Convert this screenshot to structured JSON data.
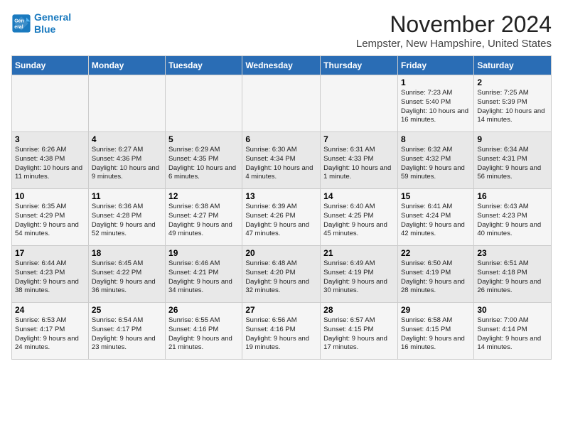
{
  "logo": {
    "line1": "General",
    "line2": "Blue"
  },
  "title": "November 2024",
  "location": "Lempster, New Hampshire, United States",
  "days_of_week": [
    "Sunday",
    "Monday",
    "Tuesday",
    "Wednesday",
    "Thursday",
    "Friday",
    "Saturday"
  ],
  "weeks": [
    [
      {
        "num": "",
        "info": ""
      },
      {
        "num": "",
        "info": ""
      },
      {
        "num": "",
        "info": ""
      },
      {
        "num": "",
        "info": ""
      },
      {
        "num": "",
        "info": ""
      },
      {
        "num": "1",
        "info": "Sunrise: 7:23 AM\nSunset: 5:40 PM\nDaylight: 10 hours and 16 minutes."
      },
      {
        "num": "2",
        "info": "Sunrise: 7:25 AM\nSunset: 5:39 PM\nDaylight: 10 hours and 14 minutes."
      }
    ],
    [
      {
        "num": "3",
        "info": "Sunrise: 6:26 AM\nSunset: 4:38 PM\nDaylight: 10 hours and 11 minutes."
      },
      {
        "num": "4",
        "info": "Sunrise: 6:27 AM\nSunset: 4:36 PM\nDaylight: 10 hours and 9 minutes."
      },
      {
        "num": "5",
        "info": "Sunrise: 6:29 AM\nSunset: 4:35 PM\nDaylight: 10 hours and 6 minutes."
      },
      {
        "num": "6",
        "info": "Sunrise: 6:30 AM\nSunset: 4:34 PM\nDaylight: 10 hours and 4 minutes."
      },
      {
        "num": "7",
        "info": "Sunrise: 6:31 AM\nSunset: 4:33 PM\nDaylight: 10 hours and 1 minute."
      },
      {
        "num": "8",
        "info": "Sunrise: 6:32 AM\nSunset: 4:32 PM\nDaylight: 9 hours and 59 minutes."
      },
      {
        "num": "9",
        "info": "Sunrise: 6:34 AM\nSunset: 4:31 PM\nDaylight: 9 hours and 56 minutes."
      }
    ],
    [
      {
        "num": "10",
        "info": "Sunrise: 6:35 AM\nSunset: 4:29 PM\nDaylight: 9 hours and 54 minutes."
      },
      {
        "num": "11",
        "info": "Sunrise: 6:36 AM\nSunset: 4:28 PM\nDaylight: 9 hours and 52 minutes."
      },
      {
        "num": "12",
        "info": "Sunrise: 6:38 AM\nSunset: 4:27 PM\nDaylight: 9 hours and 49 minutes."
      },
      {
        "num": "13",
        "info": "Sunrise: 6:39 AM\nSunset: 4:26 PM\nDaylight: 9 hours and 47 minutes."
      },
      {
        "num": "14",
        "info": "Sunrise: 6:40 AM\nSunset: 4:25 PM\nDaylight: 9 hours and 45 minutes."
      },
      {
        "num": "15",
        "info": "Sunrise: 6:41 AM\nSunset: 4:24 PM\nDaylight: 9 hours and 42 minutes."
      },
      {
        "num": "16",
        "info": "Sunrise: 6:43 AM\nSunset: 4:23 PM\nDaylight: 9 hours and 40 minutes."
      }
    ],
    [
      {
        "num": "17",
        "info": "Sunrise: 6:44 AM\nSunset: 4:23 PM\nDaylight: 9 hours and 38 minutes."
      },
      {
        "num": "18",
        "info": "Sunrise: 6:45 AM\nSunset: 4:22 PM\nDaylight: 9 hours and 36 minutes."
      },
      {
        "num": "19",
        "info": "Sunrise: 6:46 AM\nSunset: 4:21 PM\nDaylight: 9 hours and 34 minutes."
      },
      {
        "num": "20",
        "info": "Sunrise: 6:48 AM\nSunset: 4:20 PM\nDaylight: 9 hours and 32 minutes."
      },
      {
        "num": "21",
        "info": "Sunrise: 6:49 AM\nSunset: 4:19 PM\nDaylight: 9 hours and 30 minutes."
      },
      {
        "num": "22",
        "info": "Sunrise: 6:50 AM\nSunset: 4:19 PM\nDaylight: 9 hours and 28 minutes."
      },
      {
        "num": "23",
        "info": "Sunrise: 6:51 AM\nSunset: 4:18 PM\nDaylight: 9 hours and 26 minutes."
      }
    ],
    [
      {
        "num": "24",
        "info": "Sunrise: 6:53 AM\nSunset: 4:17 PM\nDaylight: 9 hours and 24 minutes."
      },
      {
        "num": "25",
        "info": "Sunrise: 6:54 AM\nSunset: 4:17 PM\nDaylight: 9 hours and 23 minutes."
      },
      {
        "num": "26",
        "info": "Sunrise: 6:55 AM\nSunset: 4:16 PM\nDaylight: 9 hours and 21 minutes."
      },
      {
        "num": "27",
        "info": "Sunrise: 6:56 AM\nSunset: 4:16 PM\nDaylight: 9 hours and 19 minutes."
      },
      {
        "num": "28",
        "info": "Sunrise: 6:57 AM\nSunset: 4:15 PM\nDaylight: 9 hours and 17 minutes."
      },
      {
        "num": "29",
        "info": "Sunrise: 6:58 AM\nSunset: 4:15 PM\nDaylight: 9 hours and 16 minutes."
      },
      {
        "num": "30",
        "info": "Sunrise: 7:00 AM\nSunset: 4:14 PM\nDaylight: 9 hours and 14 minutes."
      }
    ]
  ]
}
